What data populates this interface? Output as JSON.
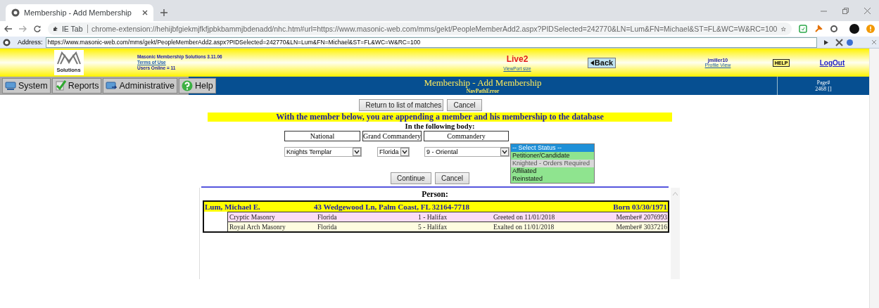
{
  "browser": {
    "tab_title": "Membership - Add Membership",
    "chip": "IE Tab",
    "url": "chrome-extension://hehijbfgiekmjfkfjpbkbammjbdenadd/nhc.htm#url=https://www.masonic-web.com/mms/gekt/PeopleMemberAdd2.aspx?PIDSelected=242770&LN=Lum&FN=Michael&ST=FL&WC=W&RC=100",
    "address_label": "Address:",
    "address": "https://www.masonic-web.com/mms/gekt/PeopleMemberAdd2.aspx?PIDSelected=242770&LN=Lum&FN=Michael&ST=FL&WC=W&RC=100"
  },
  "header": {
    "logo_text": "Solutions",
    "app_name": "Masonic Membership Solutions 3.11.06",
    "terms_link": "Terms of Use",
    "users_online": "Users Online = 11",
    "environment": "Live2",
    "viewport_link": "ViewPort size",
    "back_button": "Back",
    "user": "jmiller10",
    "profile_link": "Profile View",
    "help_badge": "HELP",
    "logout_link": "LogOut"
  },
  "nav": {
    "menu": [
      {
        "label": "System",
        "kind": "system"
      },
      {
        "label": "Reports",
        "kind": "reports"
      },
      {
        "label": "Administrative",
        "kind": "admin"
      },
      {
        "label": "Help",
        "kind": "help"
      }
    ],
    "page_title": "Membership - Add Membership",
    "page_subtitle": "NavPathError",
    "page_label": "Page#",
    "page_number": "2468 []"
  },
  "form": {
    "top_buttons": [
      "Return to list of matches",
      "Cancel"
    ],
    "banner": "With the member below, you are appending a member and his membership to the database",
    "subheading": "In the following body:",
    "columns": [
      "National",
      "Grand Commandery",
      "Commandery"
    ],
    "selects": [
      "Knights Templar",
      "Florida",
      "9 - Oriental"
    ],
    "status_options": [
      {
        "label": "-- Select Status --",
        "selected": true,
        "disabled": false
      },
      {
        "label": "Petitioner/Candidate",
        "selected": false,
        "disabled": false
      },
      {
        "label": "Knighted - Orders Required",
        "selected": false,
        "disabled": true
      },
      {
        "label": "Affiliated",
        "selected": false,
        "disabled": false
      },
      {
        "label": "Reinstated",
        "selected": false,
        "disabled": false
      }
    ],
    "bottom_buttons": [
      "Continue",
      "Cancel"
    ],
    "person_heading": "Person:",
    "person": {
      "name": "Lum, Michael E.",
      "address": "43 Wedgewood Ln, Palm Coast, FL 32164-7718",
      "born": "Born 03/30/1971"
    },
    "memberships": [
      {
        "body": "Cryptic Masonry",
        "state": "Florida",
        "unit": "1 - Halifax",
        "event": "Greeted on 11/01/2018",
        "member": "Member# 2076993",
        "color": "#fbdcf5"
      },
      {
        "body": "Royal Arch Masonry",
        "state": "Florida",
        "unit": "5 - Halifax",
        "event": "Exalted on 11/01/2018",
        "member": "Member# 3037216",
        "color": "#fefde0"
      }
    ]
  }
}
